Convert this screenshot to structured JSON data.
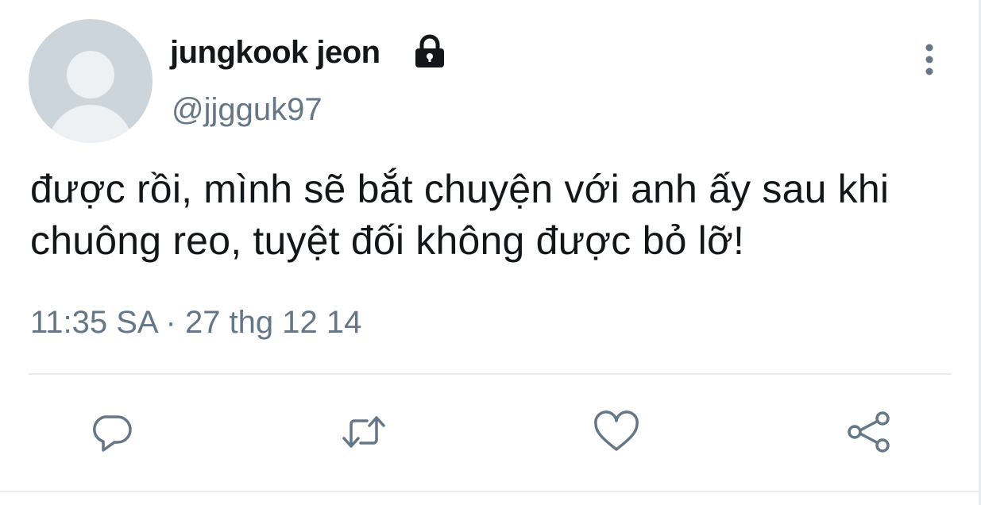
{
  "tweet": {
    "display_name": "jungkook jeon",
    "handle": "@jjgguk97",
    "text": "được rồi, mình sẽ bắt chuyện với anh ấy sau khi chuông reo, tuyệt đối không được bỏ lỡ!",
    "timestamp": "11:35 SA · 27 thg 12 14"
  },
  "icons": {
    "avatar": "default-avatar-icon",
    "lock": "lock-icon",
    "more": "more-vertical-icon",
    "reply": "reply-icon",
    "retweet": "retweet-icon",
    "like": "heart-icon",
    "share": "share-icon"
  },
  "colors": {
    "text": "#14171a",
    "secondary": "#657786",
    "divider": "#e6ecf0"
  }
}
